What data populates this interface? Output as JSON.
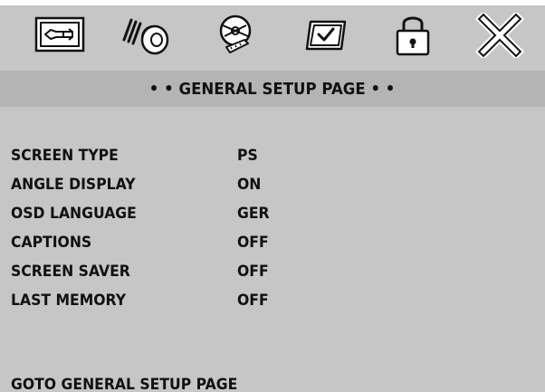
{
  "header": {
    "icons": [
      {
        "name": "general-setup-icon",
        "selected": true
      },
      {
        "name": "audio-setup-icon"
      },
      {
        "name": "video-setup-icon"
      },
      {
        "name": "preference-icon"
      },
      {
        "name": "password-icon"
      },
      {
        "name": "exit-icon"
      }
    ],
    "title": "• • GENERAL SETUP PAGE • •"
  },
  "settings": [
    {
      "label": "SCREEN TYPE",
      "value": "PS"
    },
    {
      "label": "ANGLE DISPLAY",
      "value": "ON"
    },
    {
      "label": "OSD LANGUAGE",
      "value": "GER"
    },
    {
      "label": "CAPTIONS",
      "value": "OFF"
    },
    {
      "label": "SCREEN SAVER",
      "value": "OFF"
    },
    {
      "label": "LAST MEMORY",
      "value": "OFF"
    }
  ],
  "status": "GOTO GENERAL SETUP PAGE",
  "colors": {
    "background": "#c6c6c6",
    "title_bar": "#b4b4b4",
    "text": "#111111"
  }
}
